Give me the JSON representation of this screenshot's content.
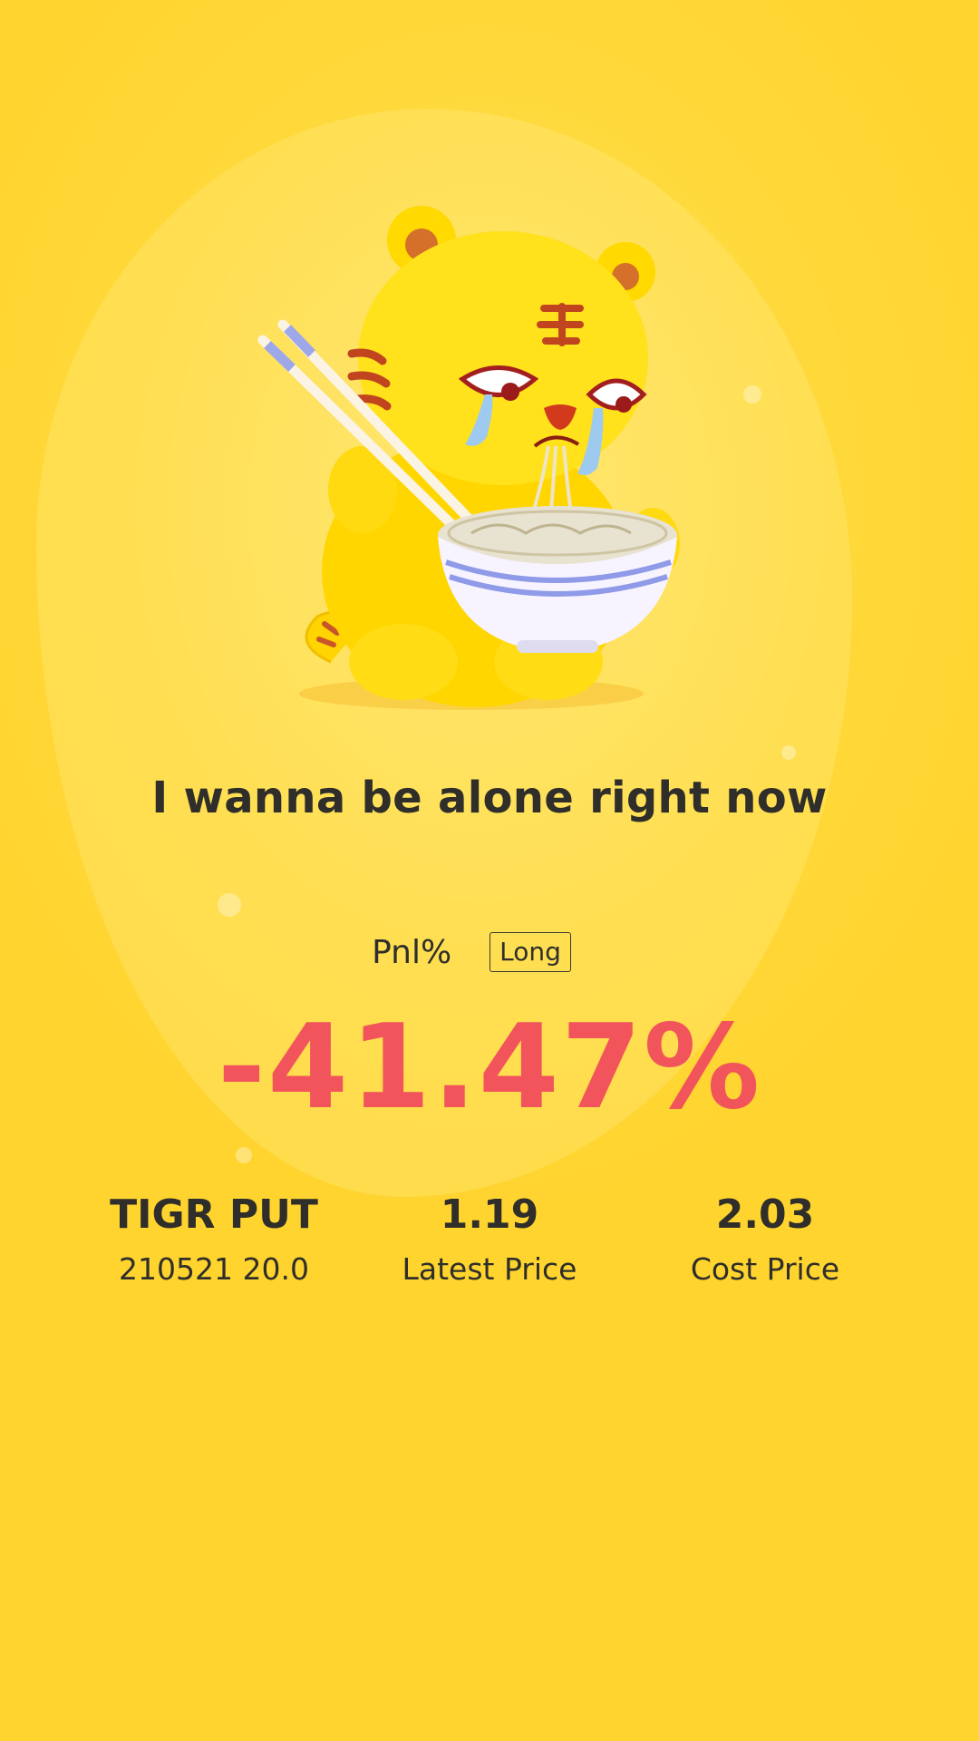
{
  "message": "I wanna be alone right now",
  "pnl": {
    "label": "Pnl%",
    "direction": "Long",
    "value": "-41.47%"
  },
  "stats": [
    {
      "main": "TIGR PUT",
      "sub": "210521 20.0"
    },
    {
      "main": "1.19",
      "sub": "Latest Price"
    },
    {
      "main": "2.03",
      "sub": "Cost Price"
    }
  ],
  "colors": {
    "background": "#ffd93b",
    "loss": "#f2545b",
    "text": "#2f2e2a"
  },
  "icons": [
    "crying-tiger-mascot"
  ]
}
